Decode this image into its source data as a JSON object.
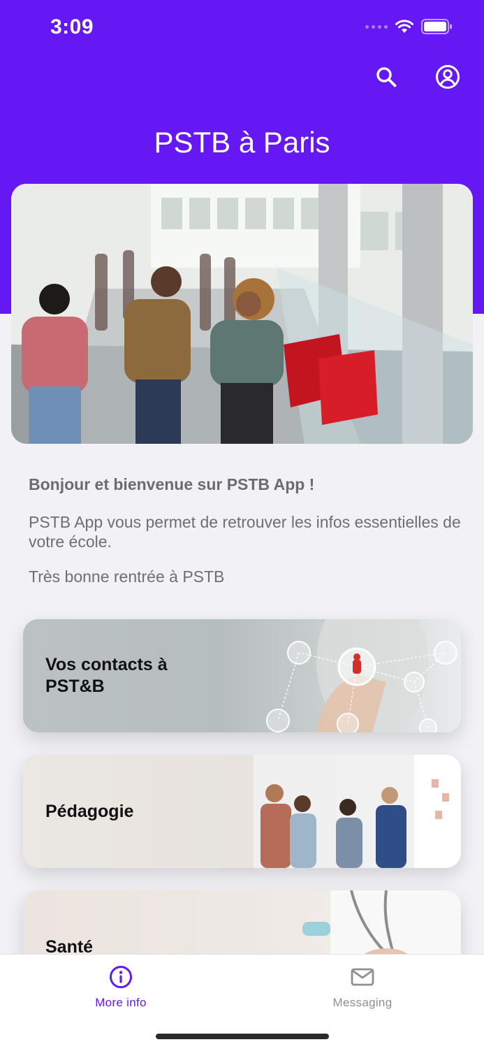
{
  "status_bar": {
    "time": "3:09"
  },
  "header": {
    "title": "PSTB à Paris",
    "search_icon": "search-icon",
    "account_icon": "account-circle-icon",
    "background_color": "#6518f4"
  },
  "welcome": {
    "title": "Bonjour et bienvenue sur PSTB App  !",
    "paragraph1": "PSTB App vous permet de retrouver les infos essentielles de votre école.",
    "paragraph2": "Très bonne rentrée à PSTB"
  },
  "cards": [
    {
      "label": "Vos contacts à PST&B"
    },
    {
      "label": "Pédagogie"
    },
    {
      "label": "Santé"
    }
  ],
  "tab_bar": {
    "tabs": [
      {
        "label": "More info",
        "icon": "info-icon",
        "active": true,
        "color": "#6518f4"
      },
      {
        "label": "Messaging",
        "icon": "mail-icon",
        "active": false,
        "color": "#8e8e93"
      }
    ]
  }
}
